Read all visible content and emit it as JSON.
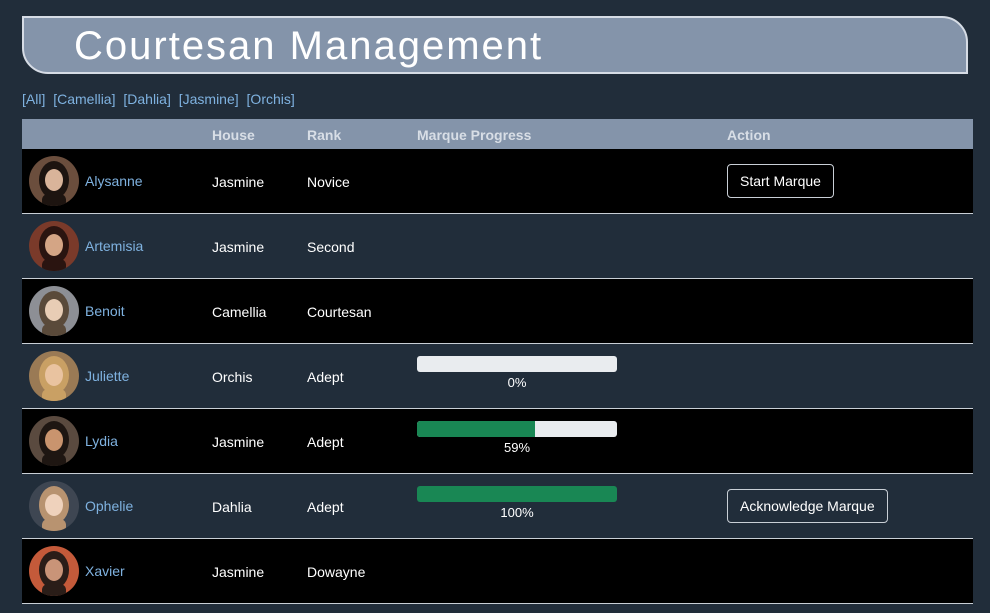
{
  "page": {
    "title": "Courtesan Management"
  },
  "filters": [
    "[All]",
    "[Camellia]",
    "[Dahlia]",
    "[Jasmine]",
    "[Orchis]"
  ],
  "table": {
    "columns": {
      "name": "",
      "house": "House",
      "rank": "Rank",
      "progress": "Marque Progress",
      "action": "Action"
    },
    "rows": [
      {
        "name": "Alysanne",
        "house": "Jasmine",
        "rank": "Novice",
        "progress": null,
        "progress_label": "",
        "action": "Start Marque"
      },
      {
        "name": "Artemisia",
        "house": "Jasmine",
        "rank": "Second",
        "progress": null,
        "progress_label": "",
        "action": ""
      },
      {
        "name": "Benoit",
        "house": "Camellia",
        "rank": "Courtesan",
        "progress": null,
        "progress_label": "",
        "action": ""
      },
      {
        "name": "Juliette",
        "house": "Orchis",
        "rank": "Adept",
        "progress": 0,
        "progress_label": "0%",
        "action": ""
      },
      {
        "name": "Lydia",
        "house": "Jasmine",
        "rank": "Adept",
        "progress": 59,
        "progress_label": "59%",
        "action": ""
      },
      {
        "name": "Ophelie",
        "house": "Dahlia",
        "rank": "Adept",
        "progress": 100,
        "progress_label": "100%",
        "action": "Acknowledge Marque"
      },
      {
        "name": "Xavier",
        "house": "Jasmine",
        "rank": "Dowayne",
        "progress": null,
        "progress_label": "",
        "action": ""
      }
    ]
  },
  "colors": {
    "background": "#212d3a",
    "header": "#8494aa",
    "link": "#7fb2e0",
    "progress_fill": "#198754",
    "progress_track": "#e9ecef"
  }
}
